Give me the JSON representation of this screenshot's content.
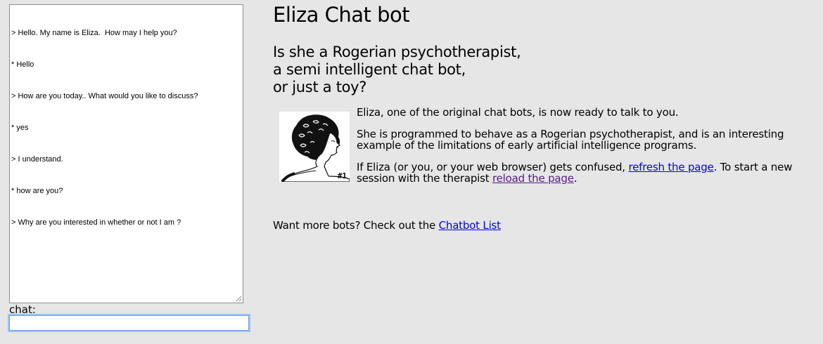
{
  "chat_log": {
    "lines": [
      "> Hello. My name is Eliza.  How may I help you?",
      "* Hello",
      "> How are you today.. What would you like to discuss?",
      "* yes",
      "> I understand.",
      "* how are you?",
      "> Why are you interested in whether or not I am ?"
    ]
  },
  "chat": {
    "label": "chat:",
    "value": ""
  },
  "page": {
    "title": "Eliza Chat bot",
    "subtitle_lines": [
      "Is she a Rogerian psychotherapist,",
      "a semi intelligent chat bot,",
      "or just a toy?"
    ],
    "image_caption": "#1",
    "paragraph1": "Eliza, one of the original chat bots, is now ready to talk to you.",
    "paragraph2": "She is programmed to behave as a Rogerian psychotherapist, and is an interesting example of the limitations of early artificial intelligence programs.",
    "paragraph3_before": "If Eliza (or you, or your web browser) gets confused, ",
    "refresh_link": "refresh the page",
    "paragraph3_middle": ". To start a new session with the therapist ",
    "reload_link": "reload the page",
    "paragraph3_end": ".",
    "more_text": "Want more bots? Check out the ",
    "chatbot_list_link": "Chatbot List"
  },
  "colors": {
    "background": "#e6e6e6",
    "link": "#0000ee",
    "visited_link": "#551a8b",
    "focus_ring": "#9ec3f5"
  }
}
